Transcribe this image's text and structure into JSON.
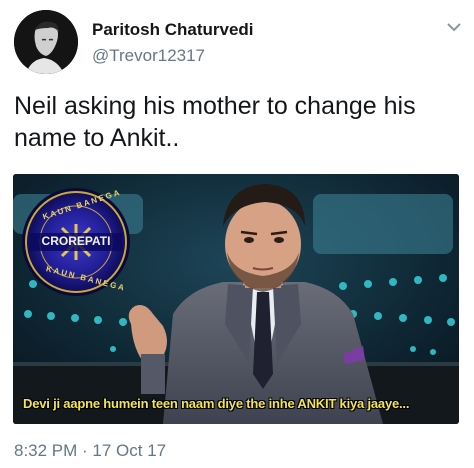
{
  "tweet": {
    "display_name": "Paritosh Chaturvedi",
    "handle": "@Trevor12317",
    "text_line1": "Neil asking his mother to change his",
    "text_line2": "name to Ankit..",
    "timestamp": "8:32 PM · 17 Oct 17"
  },
  "media": {
    "logo_text_top": "KAUN BANEGA",
    "logo_text_main": "CROREPATI",
    "logo_text_bottom": "KAUN BANEGA",
    "caption": "Devi ji aapne humein teen naam diye the inhe ANKIT kiya jaaye..."
  },
  "icons": {
    "chevron": "chevron-down-icon",
    "avatar": "user-avatar"
  },
  "colors": {
    "caption": "#f2e45a",
    "secondary_text": "#657786"
  }
}
